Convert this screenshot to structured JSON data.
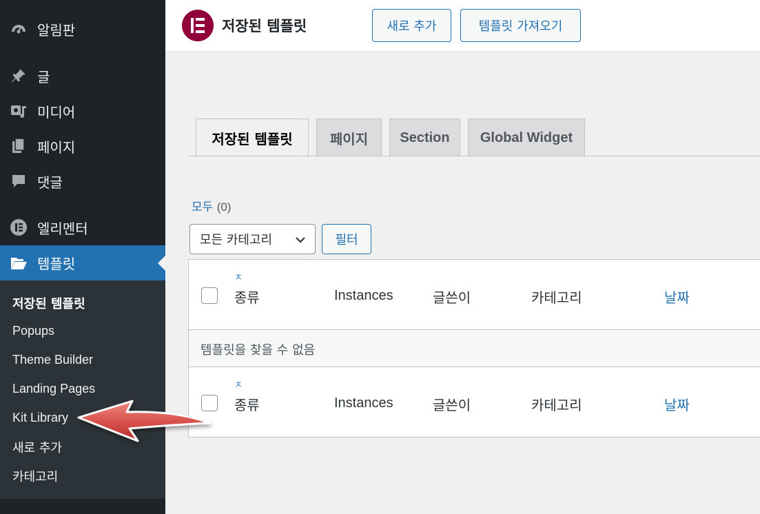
{
  "sidebar": {
    "items": [
      {
        "label": "알림판",
        "icon": "dashboard-icon"
      },
      {
        "label": "글",
        "icon": "pin-icon"
      },
      {
        "label": "미디어",
        "icon": "media-icon"
      },
      {
        "label": "페이지",
        "icon": "pages-icon"
      },
      {
        "label": "댓글",
        "icon": "comments-icon"
      },
      {
        "label": "엘리멘터",
        "icon": "elementor-icon"
      },
      {
        "label": "템플릿",
        "icon": "folder-open-icon"
      }
    ],
    "submenu": [
      "저장된 템플릿",
      "Popups",
      "Theme Builder",
      "Landing Pages",
      "Kit Library",
      "새로 추가",
      "카테고리"
    ]
  },
  "header": {
    "title": "저장된 템플릿",
    "add_new": "새로 추가",
    "import": "템플릿 가져오기",
    "brand_color": "#92003b"
  },
  "tabs": [
    "저장된 템플릿",
    "페이지",
    "Section",
    "Global Widget"
  ],
  "views": {
    "all_label": "모두",
    "all_count": "(0)"
  },
  "filters": {
    "category_selected": "모든 카테고리",
    "filter_button": "필터"
  },
  "table": {
    "title_stub": "ㅈ",
    "columns": [
      "종류",
      "Instances",
      "글쓴이",
      "카테고리",
      "날짜"
    ],
    "empty_message": "템플릿을 찾을 수 없음"
  },
  "colors": {
    "accent": "#2271b1",
    "sidebar_bg": "#1d2327",
    "annotation_arrow": "#d9534f"
  }
}
